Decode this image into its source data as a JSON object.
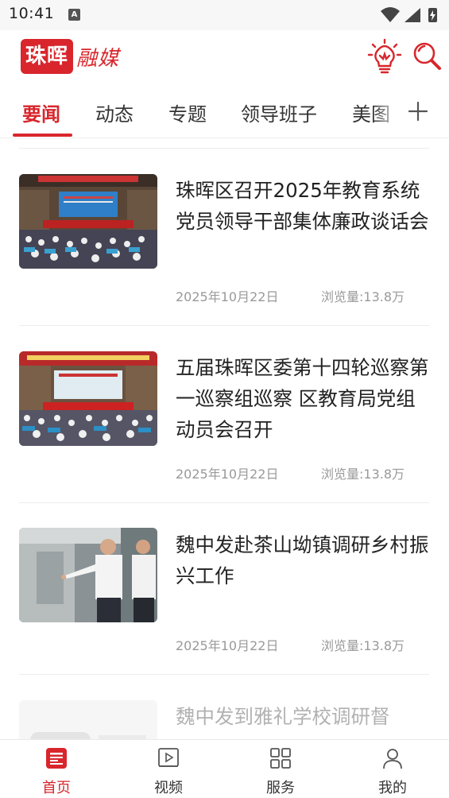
{
  "status_bar": {
    "time": "10:41",
    "notification_letter": "A"
  },
  "header": {
    "logo_box_text": "珠晖",
    "logo_text": "融媒",
    "bulb_icon": "lightbulb-icon",
    "search_icon": "search-icon",
    "brand_color": "#d8262c"
  },
  "tabs": {
    "items": [
      {
        "label": "要闻",
        "active": true
      },
      {
        "label": "动态",
        "active": false
      },
      {
        "label": "专题",
        "active": false
      },
      {
        "label": "领导班子",
        "active": false
      },
      {
        "label": "美图",
        "active": false
      }
    ],
    "add_icon": "plus-icon"
  },
  "news": [
    {
      "title": "珠晖区召开2025年教育系统党员领导干部集体廉政谈话会",
      "date": "2025年10月22日",
      "views": "浏览量:13.8万",
      "thumb": "meeting-hall-photo"
    },
    {
      "title": "五届珠晖区委第十四轮巡察第一巡察组巡察 区教育局党组动员会召开",
      "date": "2025年10月22日",
      "views": "浏览量:13.8万",
      "thumb": "meeting-hall-photo"
    },
    {
      "title": "魏中发赴茶山坳镇调研乡村振兴工作",
      "date": "2025年10月22日",
      "views": "浏览量:13.8万",
      "thumb": "officials-inspection-photo"
    },
    {
      "title": "魏中发到雅礼学校调研督",
      "thumb": "school-visit-photo"
    }
  ],
  "bottom_nav": [
    {
      "label": "首页",
      "icon": "home-icon",
      "active": true
    },
    {
      "label": "视频",
      "icon": "video-icon",
      "active": false
    },
    {
      "label": "服务",
      "icon": "grid-icon",
      "active": false
    },
    {
      "label": "我的",
      "icon": "user-icon",
      "active": false
    }
  ]
}
